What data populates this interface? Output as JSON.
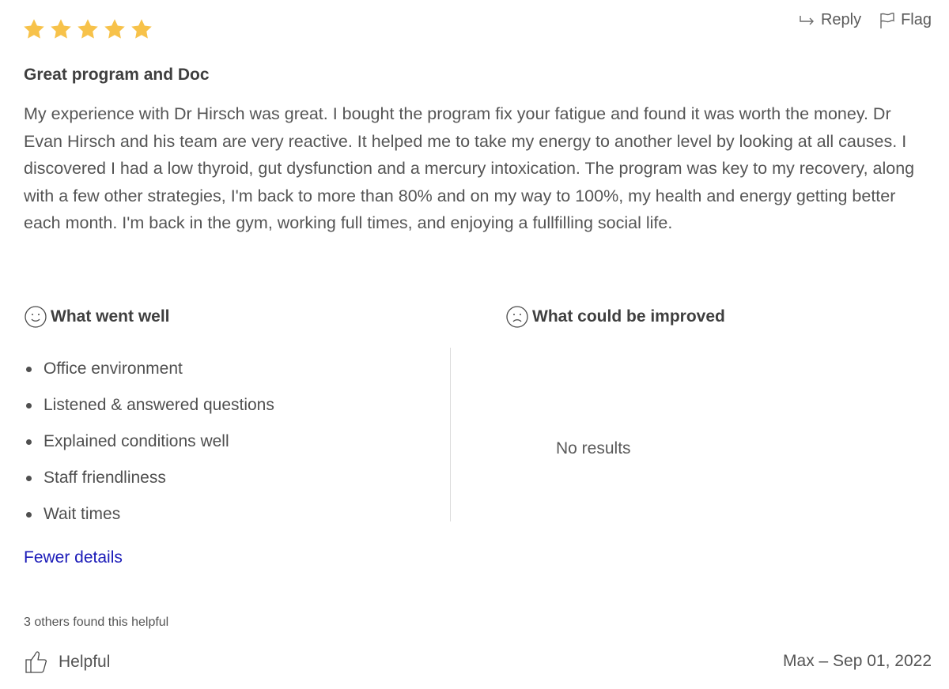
{
  "review": {
    "rating": 5,
    "rating_max": 5,
    "star_color": "#F7C24A",
    "title": "Great program and Doc",
    "body": "My experience with Dr Hirsch was great. I bought the program fix your fatigue and found it was worth the money. Dr Evan Hirsch and his team are very reactive. It helped me to take my energy to another level by looking at all causes. I discovered I had a low thyroid, gut dysfunction and a mercury intoxication. The program was key to my recovery, along with a few other strategies, I'm back to more than 80% and on my way to 100%, my health and energy getting better each month. I'm back in the gym, working full times, and enjoying a fullfilling social life.",
    "author_date": "Max – Sep 01, 2022"
  },
  "actions": {
    "reply_label": "Reply",
    "reply_icon": "reply-arrow-icon",
    "flag_label": "Flag",
    "flag_icon": "flag-icon"
  },
  "went_well": {
    "heading": "What went well",
    "icon": "smiley-face-icon",
    "items": [
      "Office environment",
      "Listened & answered questions",
      "Explained conditions well",
      "Staff friendliness",
      "Wait times"
    ]
  },
  "improved": {
    "heading": "What could be improved",
    "icon": "sad-face-icon",
    "empty_text": "No results"
  },
  "footer": {
    "fewer_details_label": "Fewer details",
    "link_color": "#1A1AB8",
    "helpful_count_text": "3 others found this helpful",
    "helpful_label": "Helpful",
    "helpful_icon": "thumbs-up-icon"
  }
}
